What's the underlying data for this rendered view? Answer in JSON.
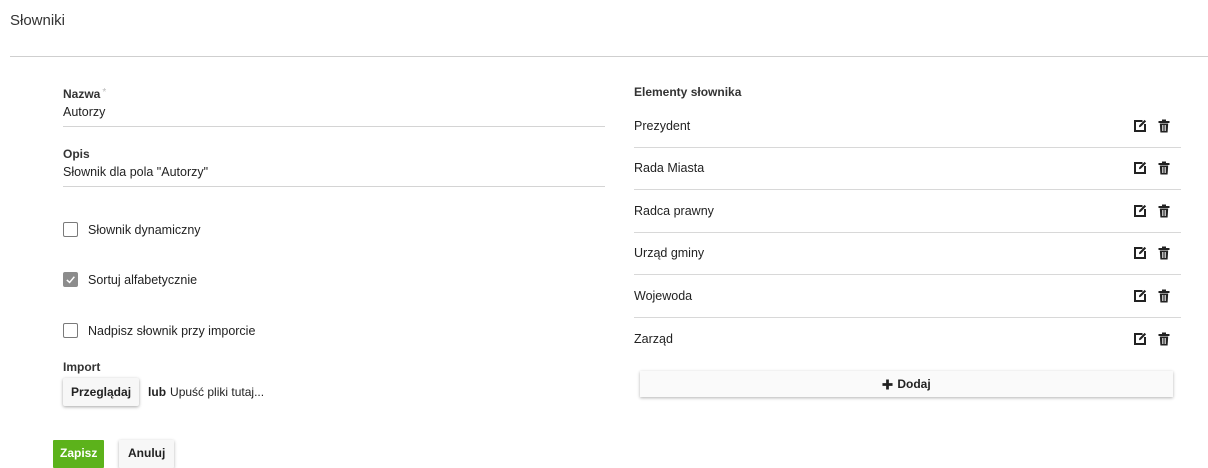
{
  "page": {
    "title": "Słowniki"
  },
  "form": {
    "name": {
      "label": "Nazwa",
      "required_mark": "*",
      "value": "Autorzy"
    },
    "description": {
      "label": "Opis",
      "value": "Słownik dla pola \"Autorzy\""
    },
    "checkboxes": [
      {
        "label": "Słownik dynamiczny",
        "checked": false
      },
      {
        "label": "Sortuj alfabetycznie",
        "checked": true
      },
      {
        "label": "Nadpisz słownik przy imporcie",
        "checked": false
      }
    ],
    "import": {
      "label": "Import",
      "browse_label": "Przeglądaj",
      "or_text": "lub",
      "drop_text": "Upuść pliki tutaj..."
    },
    "save_label": "Zapisz",
    "cancel_label": "Anuluj"
  },
  "dictionary": {
    "title": "Elementy słownika",
    "items": [
      {
        "label": "Prezydent"
      },
      {
        "label": "Rada Miasta"
      },
      {
        "label": "Radca prawny"
      },
      {
        "label": "Urząd gminy"
      },
      {
        "label": "Wojewoda"
      },
      {
        "label": "Zarząd"
      }
    ],
    "add_label": "Dodaj",
    "item_icons": [
      "edit-icon",
      "trash-icon"
    ]
  },
  "colors": {
    "primary": "#5cb21b",
    "checkbox_checked": "#8c8c8c",
    "divider": "#cfcfcf"
  }
}
